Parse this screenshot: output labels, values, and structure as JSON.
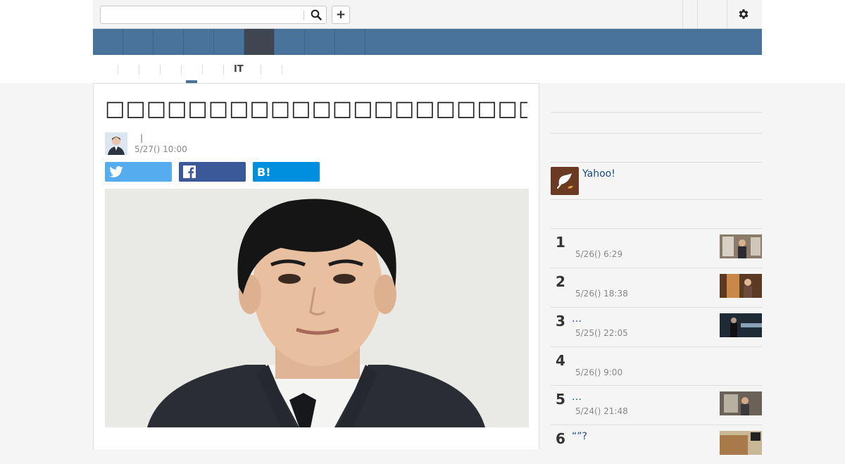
{
  "header": {
    "search_placeholder": "",
    "search_icon": "search-icon",
    "add_label": "+",
    "settings_icon": "gear-icon"
  },
  "nav": {
    "active_index": 5,
    "item_count": 9
  },
  "subnav": {
    "items": [
      "IT"
    ],
    "active_color": "#4a739c"
  },
  "article": {
    "title": "□□□□□□□□□□□□□□□□□□□□□□□□□□□□",
    "author_separator": "|",
    "date": "5/27() 10:00",
    "share": {
      "twitter_icon": "twitter-icon",
      "facebook_icon": "facebook-icon",
      "hatena_label": "B!"
    }
  },
  "sidebar": {
    "yahoo_label": "Yahoo!",
    "ranking": [
      {
        "rank": "1",
        "title": "",
        "date": "5/26() 6:29"
      },
      {
        "rank": "2",
        "title": "",
        "date": "5/26() 18:38"
      },
      {
        "rank": "3",
        "title": "…",
        "date": "5/25() 22:05"
      },
      {
        "rank": "4",
        "title": "",
        "date": "5/26() 9:00"
      },
      {
        "rank": "5",
        "title": "…",
        "date": "5/24() 21:48"
      },
      {
        "rank": "6",
        "title": "“”?",
        "date": ""
      }
    ]
  },
  "colors": {
    "nav_bg": "#4a739c",
    "nav_active": "#3f4551",
    "twitter": "#55acee",
    "facebook": "#3b5998",
    "hatena": "#008fde",
    "link": "#1a4a8c"
  }
}
